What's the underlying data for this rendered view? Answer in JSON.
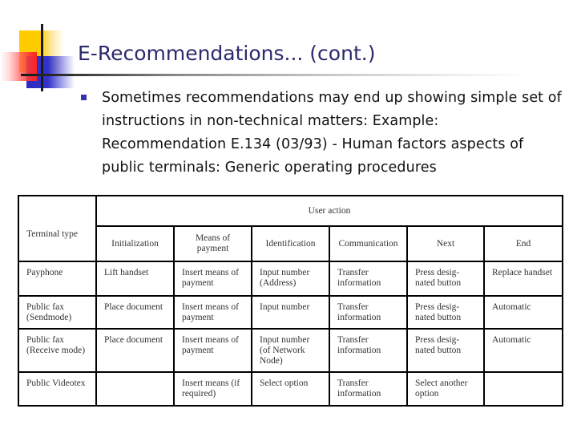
{
  "slide": {
    "title": "E-Recommendations... (cont.)",
    "bullets": [
      {
        "text": "Sometimes recommendations may end up showing simple set of instructions in non-technical matters: Example: Recommendation E.134 (03/93) - Human factors aspects of public terminals: Generic operating procedures"
      }
    ],
    "colors": {
      "title": "#2a2a6e",
      "bullet": "#3333aa",
      "deco_yellow": "#ffcc00",
      "deco_blue": "#3333cc",
      "deco_red": "#ff2020"
    }
  },
  "table": {
    "row_header_label": "Terminal type",
    "group_header": "User action",
    "columns": [
      "Initialization",
      "Means of payment",
      "Identification",
      "Communication",
      "Next",
      "End"
    ],
    "rows": [
      {
        "terminal": "Payphone",
        "cells": [
          "Lift handset",
          "Insert means of payment",
          "Input number (Address)",
          "Transfer information",
          "Press desig-nated button",
          "Replace handset"
        ]
      },
      {
        "terminal": "Public fax (Sendmode)",
        "cells": [
          "Place document",
          "Insert means of payment",
          "Input number",
          "Transfer information",
          "Press desig-nated button",
          "Automatic"
        ]
      },
      {
        "terminal": "Public fax (Receive mode)",
        "cells": [
          "Place document",
          "Insert means of payment",
          "Input number (of Network Node)",
          "Transfer information",
          "Press desig-nated button",
          "Automatic"
        ]
      },
      {
        "terminal": "Public Videotex",
        "cells": [
          "",
          "Insert means (if required)",
          "Select option",
          "Transfer information",
          "Select another option",
          ""
        ]
      }
    ]
  }
}
